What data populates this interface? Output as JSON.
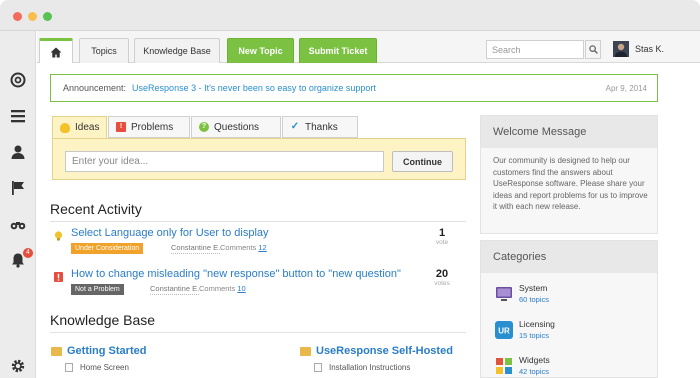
{
  "window": {
    "controls": [
      "close",
      "minimize",
      "maximize"
    ]
  },
  "sidebar": {
    "items": [
      {
        "icon": "logo-icon"
      },
      {
        "icon": "menu-icon"
      },
      {
        "icon": "user-icon"
      },
      {
        "icon": "flag-icon"
      },
      {
        "icon": "binoculars-icon"
      },
      {
        "icon": "bell-icon",
        "badge": "4"
      },
      {
        "icon": "gear-icon"
      }
    ]
  },
  "topnav": {
    "home_icon": "home-icon",
    "tabs": [
      "Topics",
      "Knowledge Base"
    ],
    "new_topic": "New Topic",
    "submit_ticket": "Submit Ticket",
    "search_placeholder": "Search",
    "username": "Stas K."
  },
  "announcement": {
    "label": "Announcement:",
    "text": "UseResponse 3 - It's never been so easy to organize support",
    "date": "Apr 9, 2014"
  },
  "composer": {
    "tabs": [
      {
        "label": "Ideas",
        "icon": "lightbulb-icon"
      },
      {
        "label": "Problems",
        "icon": "exclamation-icon"
      },
      {
        "label": "Questions",
        "icon": "question-icon"
      },
      {
        "label": "Thanks",
        "icon": "check-icon"
      }
    ],
    "input_placeholder": "Enter your idea...",
    "continue_label": "Continue"
  },
  "recent_activity": {
    "title": "Recent Activity",
    "items": [
      {
        "title": "Select Language only for User to display",
        "status": "Under Consideration",
        "status_color": "#f0a22a",
        "author": "Constantine E.",
        "comments_label": "Comments",
        "comments": "12",
        "votes": "1",
        "votes_label": "vote"
      },
      {
        "title": "How to change misleading \"new response\" button to \"new question\"",
        "status": "Not a Problem",
        "status_color": "#666666",
        "author": "Constantine E.",
        "comments_label": "Comments",
        "comments": "10",
        "votes": "20",
        "votes_label": "votes"
      }
    ]
  },
  "knowledge_base": {
    "title": "Knowledge Base",
    "categories": [
      {
        "name": "Getting Started",
        "items": [
          "Home Screen"
        ]
      },
      {
        "name": "UseResponse Self-Hosted",
        "items": [
          "Installation Instructions"
        ]
      }
    ]
  },
  "welcome": {
    "title": "Welcome Message",
    "text": "Our community is designed to help our customers find the answers about UseResponse software. Please share your ideas and report problems for us to improve it with each new release."
  },
  "categories": {
    "title": "Categories",
    "items": [
      {
        "name": "System",
        "count": "60 topics",
        "icon_color": "#6b4fa0"
      },
      {
        "name": "Licensing",
        "count": "15 topics",
        "icon_color": "#2a8fcf"
      },
      {
        "name": "Widgets",
        "count": "42 topics",
        "icon_color": "#e0543b"
      }
    ]
  }
}
